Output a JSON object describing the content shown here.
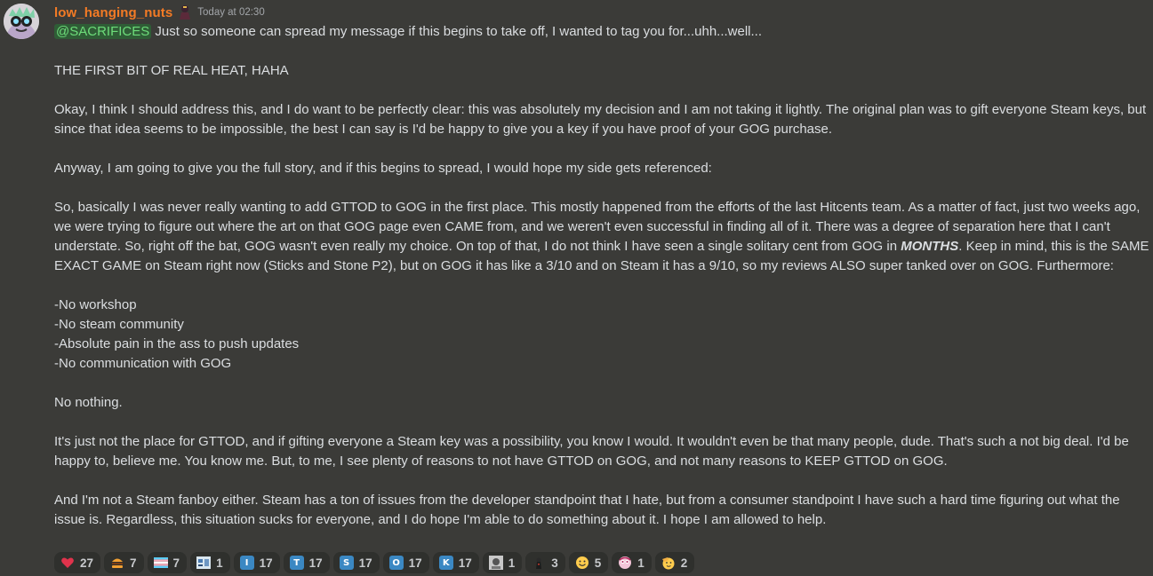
{
  "message": {
    "author": "low_hanging_nuts",
    "timestamp": "Today at 02:30",
    "mention": "@SACRIFICES",
    "first_line": " Just so someone can spread my message if this begins to take off, I wanted to tag you for...uhh...well...",
    "p1": "THE FIRST BIT OF REAL HEAT, HAHA",
    "p2": "Okay, I think I should address this, and I do want to be perfectly clear: this was absolutely my decision and I am not taking it lightly. The original plan was to gift everyone Steam keys, but since that idea seems to be impossible, the best I can say is I'd be happy to give you a key if you have proof of your GOG purchase.",
    "p3": "Anyway, I am going to give you the full story, and if this begins to spread, I would hope my side gets referenced:",
    "p4_a": "So, basically I was never really wanting to add GTTOD to GOG in the first place. This mostly happened from the efforts of the last Hitcents team. As a matter of fact, just two weeks ago, we were trying to figure out where the art on that GOG page even CAME from, and we weren't even successful in finding all of it. There was a degree of separation here that I can't understate. So, right off the bat, GOG wasn't even really my choice. On top of that, I do not think I have seen a single solitary cent from GOG in ",
    "p4_emph": "MONTHS",
    "p4_b": ". Keep in mind, this is the SAME EXACT GAME on Steam right now (Sticks and Stone P2), but on GOG it has like a 3/10 and on Steam it has a 9/10, so my reviews ALSO super tanked over on GOG. Furthermore:",
    "list": [
      "-No workshop",
      "-No steam community",
      "-Absolute pain in the ass to push updates",
      "-No communication with GOG"
    ],
    "p5": "No nothing.",
    "p6": "It's just not the place for GTTOD, and if gifting everyone a Steam key was a possibility, you know I would. It wouldn't even be that many people, dude. That's such a not big deal. I'd be happy to, believe me. You know me. But, to me, I see plenty of reasons to not have GTTOD on GOG, and not many reasons to KEEP GTTOD on GOG.",
    "p7": "And I'm not a Steam fanboy either. Steam has a ton of issues from the developer standpoint that I hate, but from a consumer standpoint I have such a hard time figuring out what the issue is. Regardless, this situation sucks for everyone, and I do hope I'm able to do something about it. I hope I am allowed to help."
  },
  "reactions": [
    {
      "icon": "heart-icon",
      "count": "27"
    },
    {
      "icon": "burger-icon",
      "count": "7"
    },
    {
      "icon": "flag-icon",
      "count": "7"
    },
    {
      "icon": "custom-emote-icon",
      "count": "1"
    },
    {
      "icon": "letter-i-icon",
      "letter": "I",
      "count": "17"
    },
    {
      "icon": "letter-t-icon",
      "letter": "T",
      "count": "17"
    },
    {
      "icon": "letter-s-icon",
      "letter": "S",
      "count": "17"
    },
    {
      "icon": "letter-o-icon",
      "letter": "O",
      "count": "17"
    },
    {
      "icon": "letter-k-icon",
      "letter": "K",
      "count": "17"
    },
    {
      "icon": "custom-emote-icon",
      "count": "1"
    },
    {
      "icon": "custom-emote-icon",
      "count": "3"
    },
    {
      "icon": "smile-icon",
      "count": "5"
    },
    {
      "icon": "custom-emote-icon",
      "count": "1"
    },
    {
      "icon": "saluting-face-icon",
      "count": "2"
    }
  ],
  "colors": {
    "background": "#3b3b38",
    "username": "#f47b25",
    "mention_text": "#6ddc7a",
    "mention_bg": "#2f5d36",
    "reaction_bg": "#2f302d",
    "letter_emoji": "#3b88c3"
  }
}
